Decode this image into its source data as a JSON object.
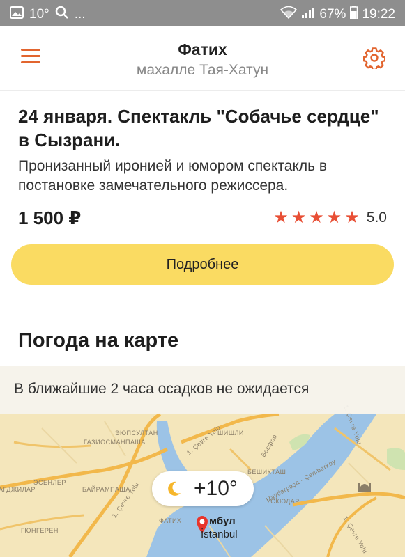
{
  "status_bar": {
    "temperature": "10°",
    "ellipsis": "...",
    "battery": "67%",
    "time": "19:22"
  },
  "header": {
    "title": "Фатих",
    "subtitle": "махалле Тая-Хатун"
  },
  "event": {
    "title": "24 января. Спектакль \"Собачье сердце\" в Сызрани.",
    "description": "Пронизанный иронией и юмором спектакль в постановке замечательного режиссера.",
    "price": "1 500 ₽",
    "rating": "5.0",
    "rating_stars": 5,
    "button_label": "Подробнее"
  },
  "map_section": {
    "title": "Погода на карте",
    "forecast": "В ближайшие 2 часа осадков не ожидается",
    "temperature": "+10°",
    "city_ru": "мбул",
    "city_en": "İstanbul",
    "labels": {
      "gaziosmanpasha": "ГАЗИОСМАНПАША",
      "eyupsultan": "ЭЮПСУЛТАН",
      "esenler": "ЭСЕНЛЕР",
      "bayrampasha": "БАЙРАМПАША",
      "bagcilar": "АГДЖИЛАР",
      "fatih": "ФАТИХ",
      "gungoren": "ГЮНГЕРЕН",
      "sisli": "ШИШЛИ",
      "besiktas": "БЕШИКТАШ",
      "uskudar": "УСКЮДАР",
      "ring_1": "1. Çevre Yolu",
      "ring_2": "1. Çevre Yolu",
      "bosphorus": "Босфор",
      "haydarpasa": "Haydarpaşa - Çemberköy",
      "ring_3": "1. Çevre Yolu",
      "ring_4": "1. Çevre Yolu"
    }
  },
  "colors": {
    "accent": "#e2652f",
    "button": "#fadb62",
    "star": "#e84f35",
    "statusbar": "#8e8e8e",
    "water": "#9cc3e6"
  }
}
